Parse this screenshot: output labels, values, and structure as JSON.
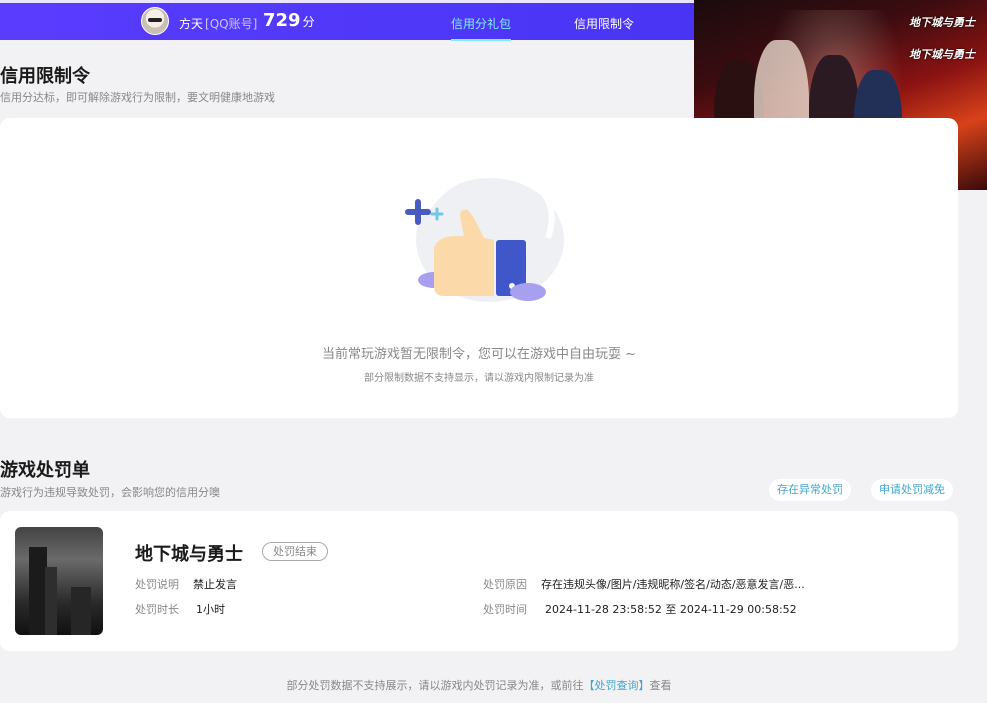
{
  "header": {
    "user_name": "方天",
    "account_type": "[QQ账号]",
    "score": "729",
    "score_unit": "分",
    "tabs": [
      {
        "label": "信用分礼包",
        "active": true
      },
      {
        "label": "信用限制令",
        "active": false
      }
    ],
    "accent_color": "#4b36f5",
    "active_tab_color": "#7ef0f5"
  },
  "banner": {
    "logo_top": "地下城与勇士",
    "logo_bottom": "地下城与勇士"
  },
  "restriction": {
    "title": "信用限制令",
    "subtitle": "信用分达标，即可解除游戏行为限制，要文明健康地游戏",
    "empty_main": "当前常玩游戏暂无限制令，您可以在游戏中自由玩耍 ~",
    "empty_sub": "部分限制数据不支持显示，请以游戏内限制记录为准"
  },
  "punishment": {
    "title": "游戏处罚单",
    "subtitle": "游戏行为违规导致处罚，会影响您的信用分噢",
    "btn_abnormal": "存在异常处罚",
    "btn_reduce": "申请处罚减免",
    "record": {
      "game": "地下城与勇士",
      "status": "处罚结束",
      "desc_label": "处罚说明",
      "desc_value": "禁止发言",
      "duration_label": "处罚时长",
      "duration_value": "1小时",
      "reason_label": "处罚原因",
      "reason_value": "存在违规头像/图片/违规昵称/签名/动态/恶意发言/恶...",
      "time_label": "处罚时间",
      "time_value": "2024-11-28 23:58:52 至 2024-11-29 00:58:52"
    }
  },
  "footer": {
    "text_before": "部分处罚数据不支持展示，请以游戏内处罚记录为准，或前往",
    "link": "【处罚查询】",
    "text_after": "查看"
  }
}
